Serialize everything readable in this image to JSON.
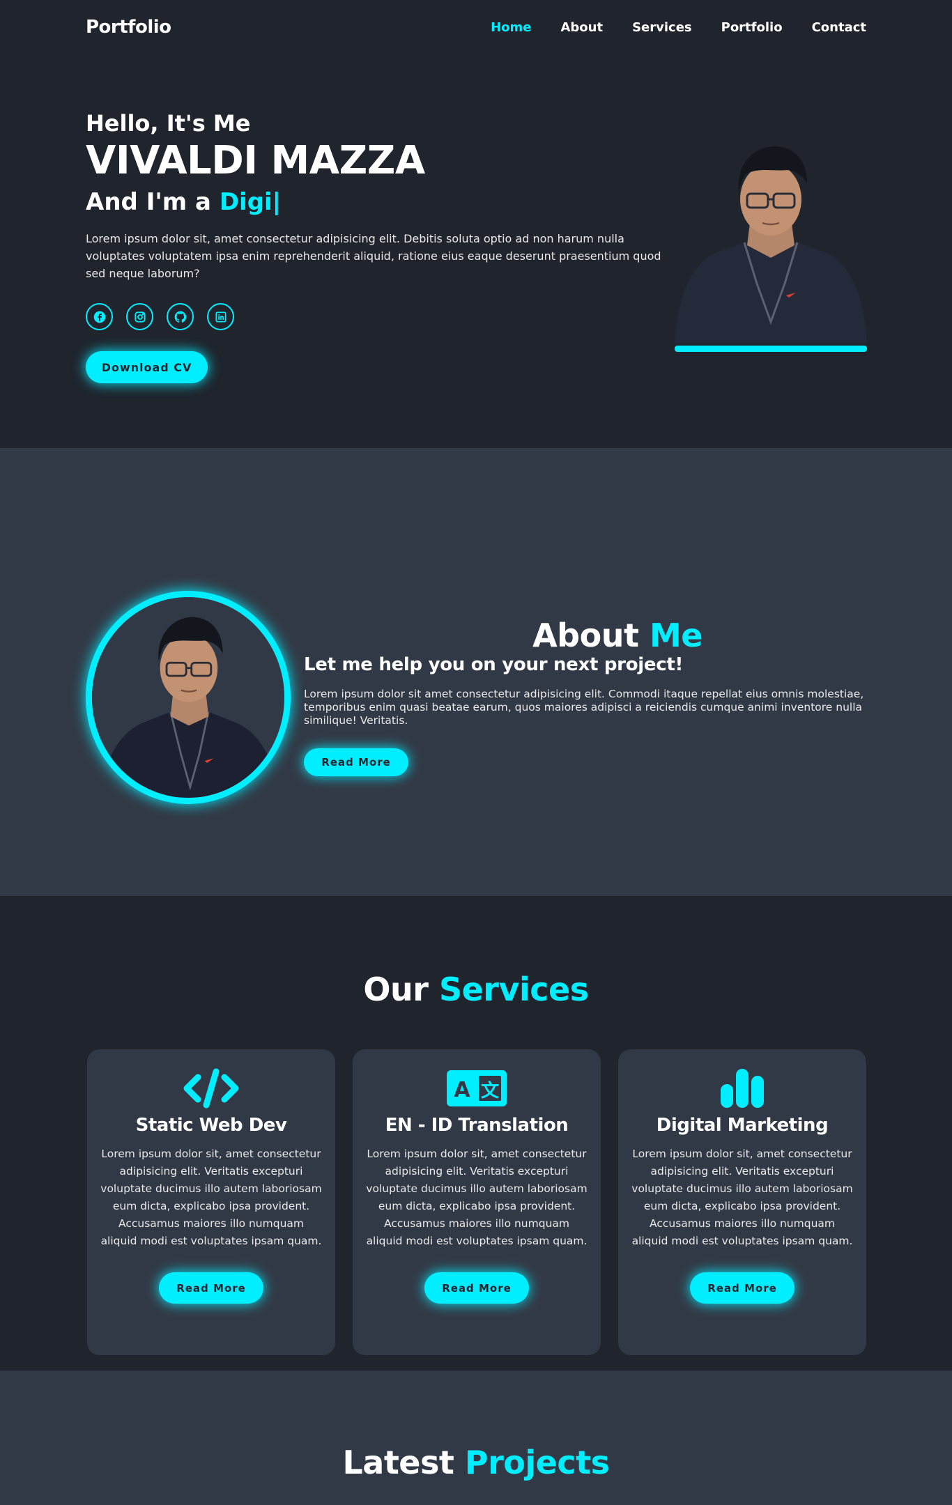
{
  "header": {
    "logo": "Portfolio",
    "nav": [
      {
        "label": "Home",
        "active": true
      },
      {
        "label": "About"
      },
      {
        "label": "Services"
      },
      {
        "label": "Portfolio"
      },
      {
        "label": "Contact"
      }
    ]
  },
  "home": {
    "greeting": "Hello, It's Me",
    "name": "VIVALDI MAZZA",
    "role_prefix": "And I'm a",
    "role_typed": "Digi|",
    "text": "Lorem ipsum dolor sit, amet consectetur adipisicing elit. Debitis soluta optio ad non harum nulla voluptates voluptatem ipsa enim reprehenderit aliquid, ratione eius eaque deserunt praesentium quod sed neque laborum?",
    "socials": [
      "facebook-icon",
      "instagram-icon",
      "github-icon",
      "linkedin-icon"
    ],
    "cv_button": "Download CV"
  },
  "about": {
    "title_main": "About",
    "title_accent": "Me",
    "subtitle": "Let me help you on your next project!",
    "text": "Lorem ipsum dolor sit amet consectetur adipisicing elit. Commodi itaque repellat eius omnis molestiae, temporibus enim quasi beatae earum, quos maiores adipisci a reiciendis cumque animi inventore nulla similique! Veritatis.",
    "button": "Read More"
  },
  "services": {
    "title_main": "Our",
    "title_accent": "Services",
    "cards": [
      {
        "icon": "code-icon",
        "title": "Static Web Dev",
        "text": "Lorem ipsum dolor sit, amet consectetur adipisicing elit. Veritatis excepturi voluptate ducimus illo autem laboriosam eum dicta, explicabo ipsa provident. Accusamus maiores illo numquam aliquid modi est voluptates ipsam quam.",
        "button": "Read More"
      },
      {
        "icon": "translate-icon",
        "title": "EN - ID Translation",
        "text": "Lorem ipsum dolor sit, amet consectetur adipisicing elit. Veritatis excepturi voluptate ducimus illo autem laboriosam eum dicta, explicabo ipsa provident. Accusamus maiores illo numquam aliquid modi est voluptates ipsam quam.",
        "button": "Read More"
      },
      {
        "icon": "bar-chart-icon",
        "title": "Digital Marketing",
        "text": "Lorem ipsum dolor sit, amet consectetur adipisicing elit. Veritatis excepturi voluptate ducimus illo autem laboriosam eum dicta, explicabo ipsa provident. Accusamus maiores illo numquam aliquid modi est voluptates ipsam quam.",
        "button": "Read More"
      }
    ]
  },
  "projects": {
    "title_main": "Latest",
    "title_accent": "Projects"
  },
  "colors": {
    "accent": "#00eeff",
    "background": "#1f242d",
    "background_alt": "#323946"
  }
}
